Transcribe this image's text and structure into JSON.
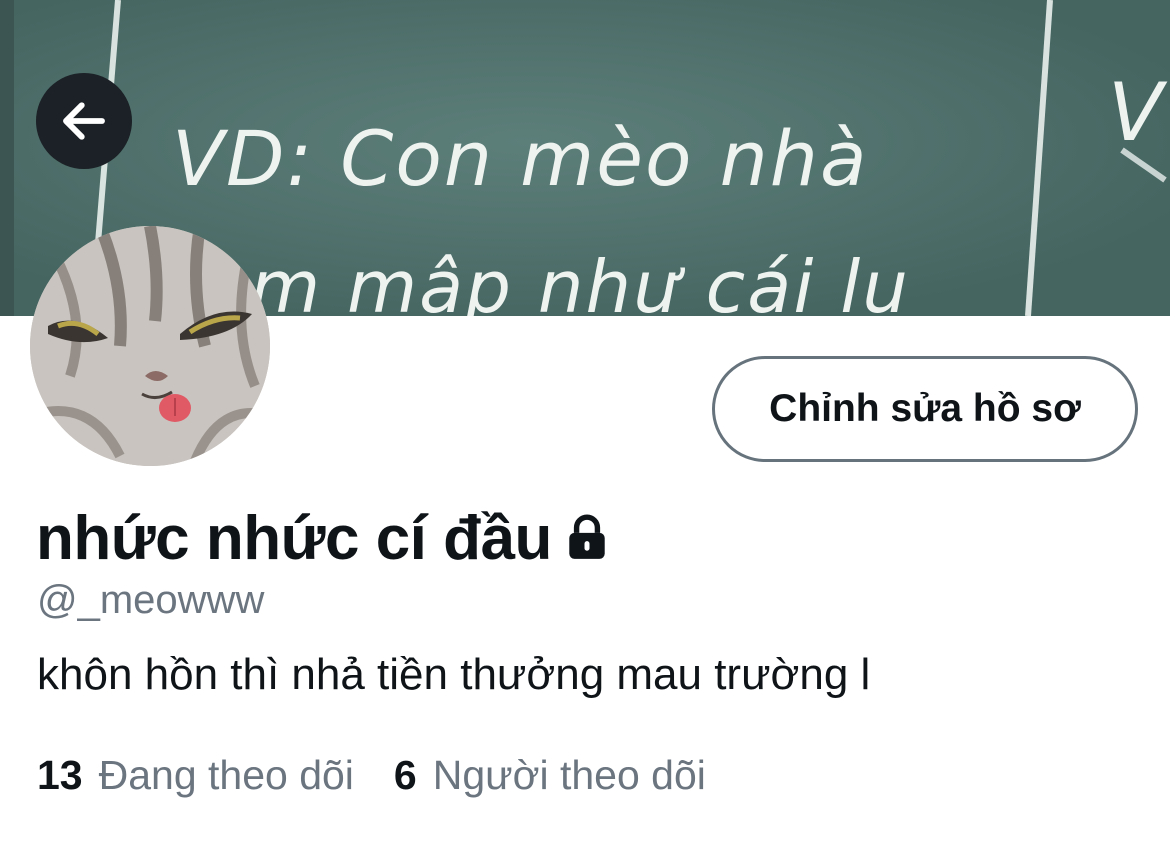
{
  "banner": {
    "chalk_lines": [
      "VD: Con mèo nhà",
      "m mập như cái lu",
      "V"
    ]
  },
  "profile": {
    "display_name": "nhức nhức cí đầu",
    "handle": "@_meowww",
    "bio": "khôn hồn thì nhả tiền thưởng mau trường l",
    "edit_button_label": "Chỉnh sửa hồ sơ",
    "locked": true
  },
  "stats": {
    "following_count": "13",
    "following_label": "Đang theo dõi",
    "followers_count": "6",
    "followers_label": "Người theo dõi"
  },
  "icons": {
    "back": "arrow-left-icon",
    "lock": "lock-icon"
  },
  "colors": {
    "chalkboard": "#4f6f6b",
    "text_primary": "#0f1419",
    "text_secondary": "#6b7580",
    "button_border": "#66737d",
    "back_button_bg": "#1b2126"
  }
}
